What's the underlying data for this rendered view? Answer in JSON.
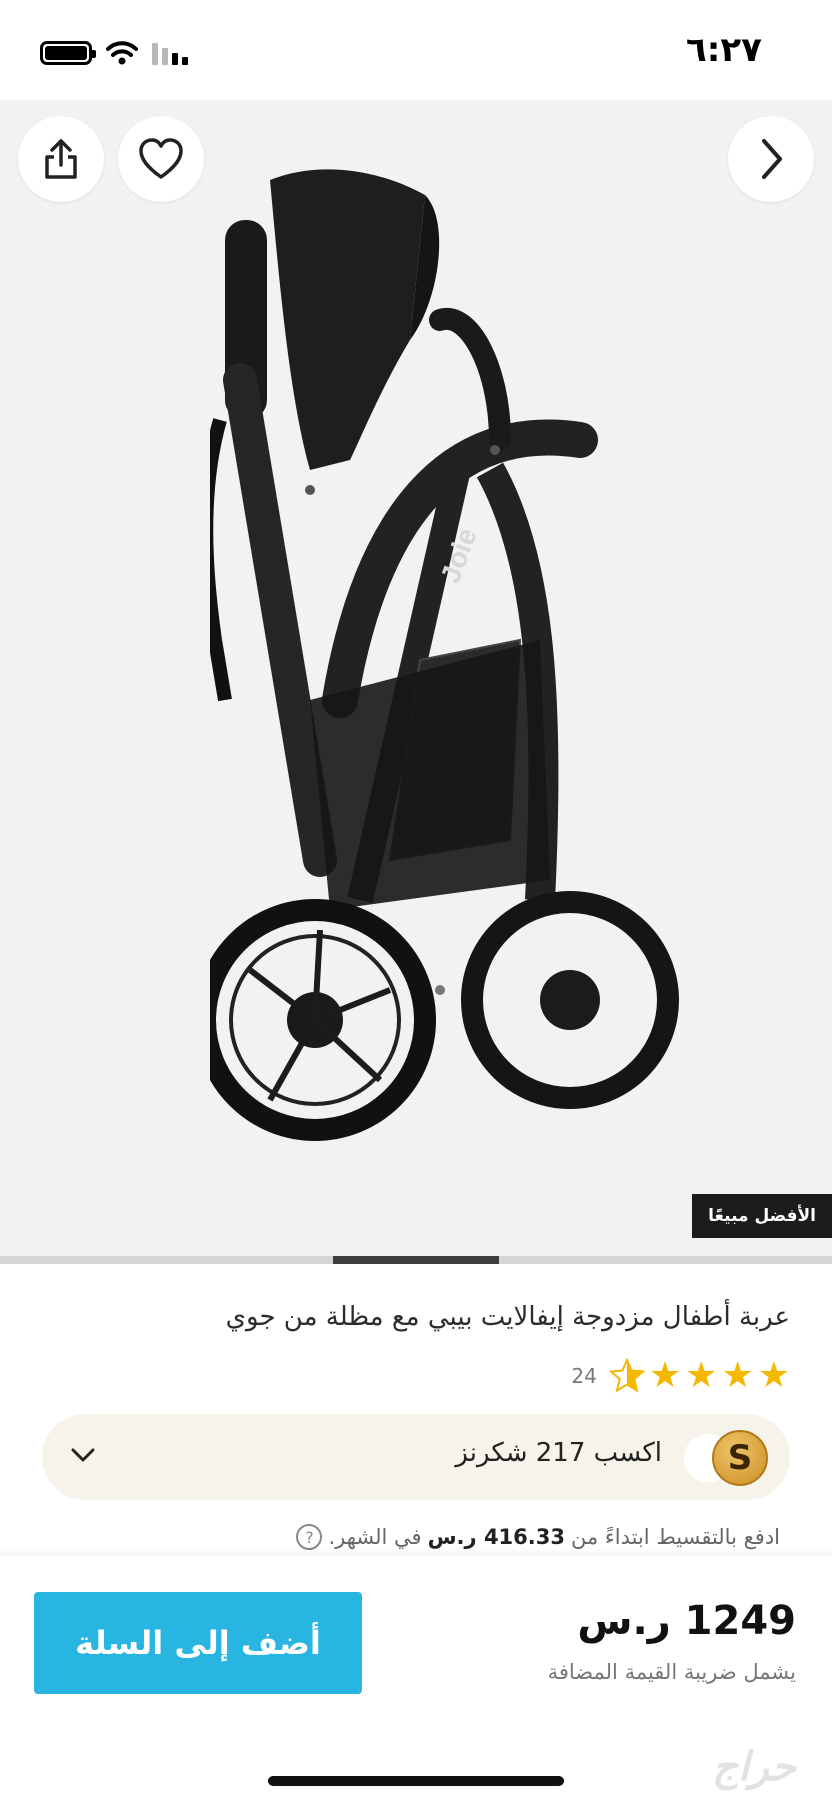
{
  "status_bar": {
    "time": "٦:٢٧"
  },
  "hero": {
    "badge": "الأفضل مبيعًا",
    "image_brand": "Joie",
    "gallery_progress": {
      "current_fraction_start": 0.4,
      "current_fraction_end": 0.6
    }
  },
  "product": {
    "title": "عربة أطفال مزدوجة إيفالايت بيبي مع مظلة من جوي",
    "rating": {
      "stars": 4.5,
      "count": "24"
    }
  },
  "shukrans": {
    "coin_letter": "S",
    "text": "اكسب 217 شكرنز"
  },
  "installment": {
    "prefix": "ادفع بالتقسيط ابتداءً من",
    "amount": "416.33 ر.س",
    "suffix": "في الشهر.",
    "help": "?"
  },
  "bottom_bar": {
    "price": "1249 ر.س",
    "vat_note": "يشمل ضريبة القيمة المضافة",
    "add_to_cart": "أضف إلى السلة",
    "watermark": "حراج"
  },
  "colors": {
    "accent": "#29b5e1",
    "star": "#f5b800",
    "badge_bg": "#1c1c1c",
    "shukrans_bg": "#f6f3ea"
  },
  "icons": {
    "share": "share-icon",
    "favorite": "heart-icon",
    "next": "chevron-right-icon",
    "expand": "chevron-down-icon"
  }
}
